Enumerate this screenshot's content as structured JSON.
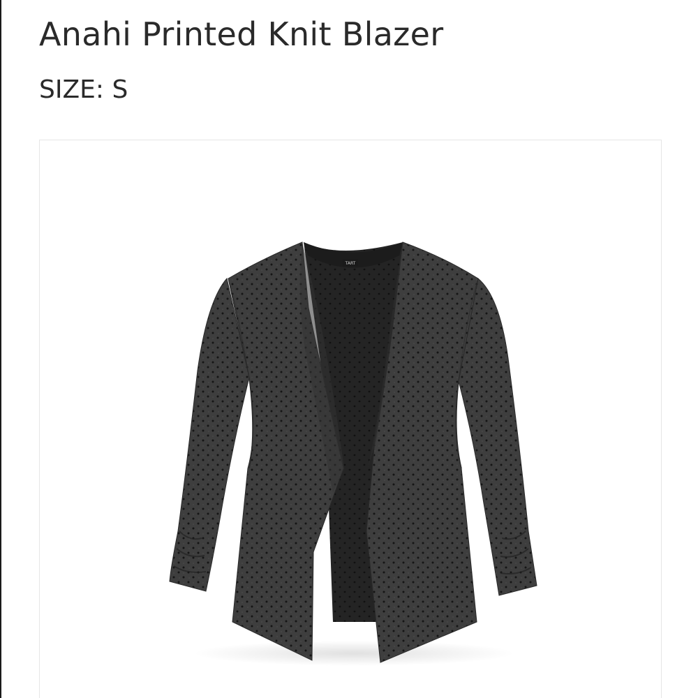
{
  "product": {
    "title": "Anahi Printed Knit Blazer",
    "size_line": "SIZE: S",
    "image": {
      "subject": "dark heather grey open-front knit blazer with black dot print and ruched sleeves",
      "label_text": "TART",
      "colors": {
        "fabric": "#3d3d3d",
        "fabric_dark": "#2a2a2a",
        "inner_top": "#1f1f1f",
        "dots": "#141414"
      }
    }
  }
}
